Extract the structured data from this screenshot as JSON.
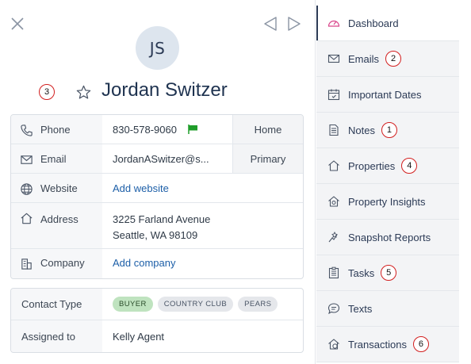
{
  "contact": {
    "initials": "JS",
    "name": "Jordan Switzer"
  },
  "details": {
    "phone": {
      "label": "Phone",
      "value": "830-578-9060",
      "tag": "Home"
    },
    "email": {
      "label": "Email",
      "value": "JordanASwitzer@s...",
      "tag": "Primary"
    },
    "website": {
      "label": "Website",
      "value": "Add website"
    },
    "address": {
      "label": "Address",
      "line1": "3225 Farland Avenue",
      "line2": "Seattle, WA 98109"
    },
    "company": {
      "label": "Company",
      "value": "Add company"
    }
  },
  "meta": {
    "contact_type": {
      "label": "Contact Type",
      "tags": [
        "BUYER",
        "COUNTRY CLUB",
        "PEARS"
      ]
    },
    "assigned_to": {
      "label": "Assigned to",
      "value": "Kelly Agent"
    }
  },
  "sidebar": {
    "items": [
      {
        "label": "Dashboard",
        "icon": "dashboard-icon",
        "active": true
      },
      {
        "label": "Emails",
        "icon": "mail-icon",
        "badge": "2"
      },
      {
        "label": "Important Dates",
        "icon": "calendar-icon"
      },
      {
        "label": "Notes",
        "icon": "note-icon",
        "badge": "1"
      },
      {
        "label": "Properties",
        "icon": "home-icon",
        "badge": "4"
      },
      {
        "label": "Property Insights",
        "icon": "home-insight-icon"
      },
      {
        "label": "Snapshot Reports",
        "icon": "snapshot-icon"
      },
      {
        "label": "Tasks",
        "icon": "tasks-icon",
        "badge": "5"
      },
      {
        "label": "Texts",
        "icon": "chat-icon"
      },
      {
        "label": "Transactions",
        "icon": "transaction-icon",
        "badge": "6"
      }
    ]
  },
  "annotations": {
    "name_badge": "3"
  },
  "colors": {
    "name": "#1f3350",
    "link": "#1d5fa8",
    "badge_border": "#d21f1f",
    "chip_buyer": "#bfe3bf",
    "chip_default": "#e5e7eb",
    "flag": "#1f9d2a",
    "dashboard_icon": "#d9468b"
  }
}
